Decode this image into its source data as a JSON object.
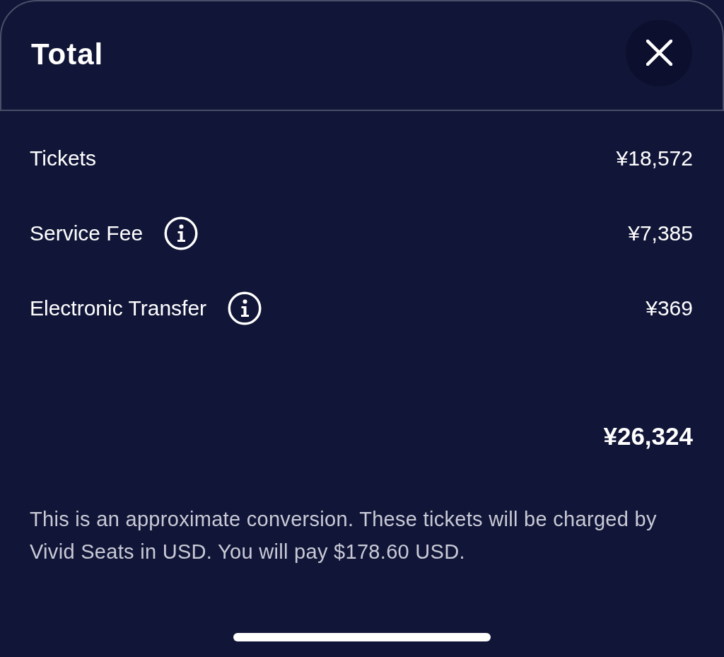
{
  "header": {
    "title": "Total"
  },
  "line_items": [
    {
      "label": "Tickets",
      "info": false,
      "amount": "¥18,572"
    },
    {
      "label": "Service Fee",
      "info": true,
      "amount": "¥7,385"
    },
    {
      "label": "Electronic Transfer",
      "info": true,
      "amount": "¥369"
    }
  ],
  "total": "¥26,324",
  "note": "This is an approximate conversion. These tickets will be charged by Vivid Seats in USD. You will pay $178.60 USD."
}
